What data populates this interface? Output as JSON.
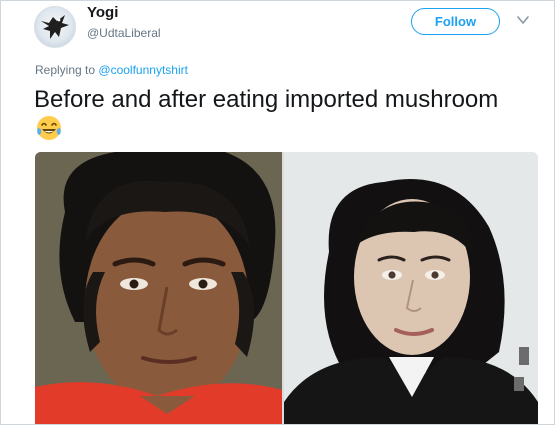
{
  "tweet": {
    "display_name": "Yogi",
    "handle": "@UdtaLiberal",
    "follow_label": "Follow",
    "reply_prefix": "Replying to",
    "reply_mention": "@coolfunnytshirt",
    "text": "Before and after eating imported mushroom",
    "emoji": "face-with-tears-of-joy"
  },
  "icons": {
    "avatar": "eagle-avatar-icon",
    "caret": "chevron-down-icon"
  },
  "colors": {
    "accent": "#1da1f2",
    "text": "#14171a",
    "muted": "#657786"
  }
}
